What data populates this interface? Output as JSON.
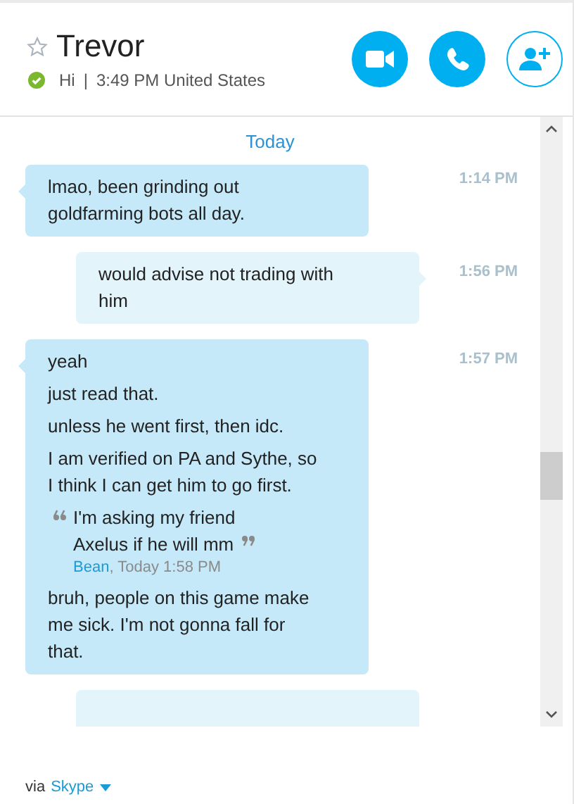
{
  "contact": {
    "name": "Trevor",
    "favorite": false,
    "online": true,
    "mood": "Hi",
    "separator": "|",
    "local_time": "3:49 PM United States"
  },
  "actions": [
    {
      "kind": "video"
    },
    {
      "kind": "call"
    },
    {
      "kind": "add_contact"
    }
  ],
  "date_divider": "Today",
  "messages": [
    {
      "kind": "incoming",
      "time": "1:14 PM",
      "paragraphs": [
        {
          "kind": "text",
          "text": "lmao, been grinding out\ngoldfarming bots all day."
        }
      ]
    },
    {
      "kind": "outgoing",
      "time": "1:56 PM",
      "paragraphs": [
        {
          "kind": "text",
          "text": "would advise not trading with\nhim"
        }
      ]
    },
    {
      "kind": "incoming",
      "time": "1:57 PM",
      "paragraphs": [
        {
          "kind": "text",
          "text": "yeah"
        },
        {
          "kind": "text",
          "text": "just read that."
        },
        {
          "kind": "text",
          "text": "unless he went first, then idc."
        },
        {
          "kind": "text",
          "text": "I am verified on PA and Sythe, so\nI think I can get him to go first."
        },
        {
          "kind": "quote",
          "text": "I'm asking my friend\nAxelus if he will mm",
          "author": "Bean",
          "meta": ", Today 1:58 PM"
        },
        {
          "kind": "text",
          "text": "bruh, people on this game make\nme sick. I'm not gonna fall for\nthat."
        }
      ]
    },
    {
      "kind": "outgoing"
    }
  ],
  "footer": {
    "prefix": "via",
    "link": "Skype"
  }
}
